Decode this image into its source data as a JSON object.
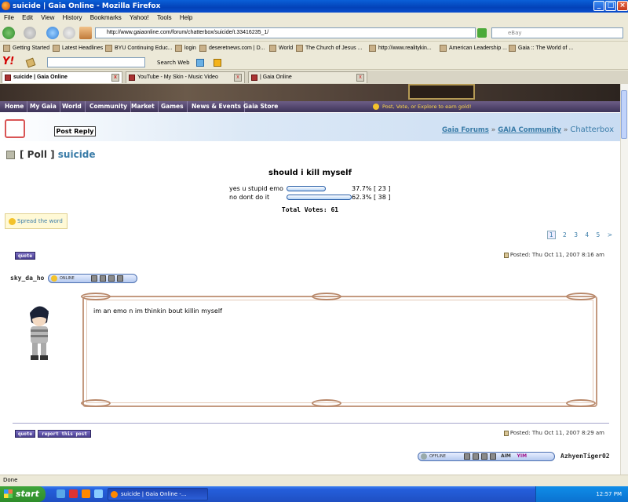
{
  "window": {
    "title": "suicide | Gaia Online - Mozilla Firefox"
  },
  "menu": [
    "File",
    "Edit",
    "View",
    "History",
    "Bookmarks",
    "Yahoo!",
    "Tools",
    "Help"
  ],
  "nav": {
    "url": "http://www.gaiaonline.com/forum/chatterbox/suicide/t.33416235_1/",
    "search_placeholder": "eBay"
  },
  "bookmarks": [
    "Getting Started",
    "Latest Headlines",
    "BYU Continuing Educ...",
    "login",
    "deseretnews.com | D...",
    "World",
    "The Church of Jesus ...",
    "http://www.realitykin...",
    "American Leadership ...",
    "Gaia :: The World of ..."
  ],
  "yahoo": {
    "logo": "Y!",
    "search_label": "Search Web"
  },
  "tabs": [
    {
      "label": "suicide | Gaia Online"
    },
    {
      "label": "YouTube - My Skin - Music Video"
    },
    {
      "label": "| Gaia Online"
    }
  ],
  "gaia_nav": [
    "Home",
    "My Gaia",
    "World",
    "Community",
    "Market",
    "Games",
    "News & Events",
    "Gaia Store"
  ],
  "gaia_promo": "Post, Vote, or Explore to earn gold!",
  "post_reply": "Post Reply",
  "breadcrumb": {
    "a": "Gaia Forums",
    "sep1": "»",
    "b": "GAIA Community",
    "sep2": "»",
    "c": "Chatterbox"
  },
  "thread": {
    "prefix": "[ Poll ]",
    "title": "suicide"
  },
  "poll": {
    "question": "should i kill myself",
    "options": [
      {
        "label": "yes u stupid emo",
        "percent": "37.7%",
        "votes": "[ 23 ]",
        "fraction": 0.377
      },
      {
        "label": "no dont do it",
        "percent": "62.3%",
        "votes": "[ 38 ]",
        "fraction": 0.623
      }
    ],
    "total": "Total Votes: 61"
  },
  "spread": "Spread the word",
  "pager": [
    "1",
    "2",
    "3",
    "4",
    "5",
    ">"
  ],
  "posts": [
    {
      "quote": "quote",
      "posted": "Posted: Thu Oct 11, 2007 8:16 am",
      "user": "sky_da_ho",
      "status": "ONLINE",
      "body": "im an emo n im thinkin bout killin myself"
    },
    {
      "quote": "quote",
      "report": "report this post",
      "posted": "Posted: Thu Oct 11, 2007 8:29 am",
      "user": "AzhyenTiger02",
      "status": "OFFLINE",
      "aim": "AIM",
      "yim": "YIM"
    }
  ],
  "statusbar": "Done",
  "taskbar": {
    "start": "start",
    "item": "suicide | Gaia Online -...",
    "clock": "12:57 PM"
  }
}
